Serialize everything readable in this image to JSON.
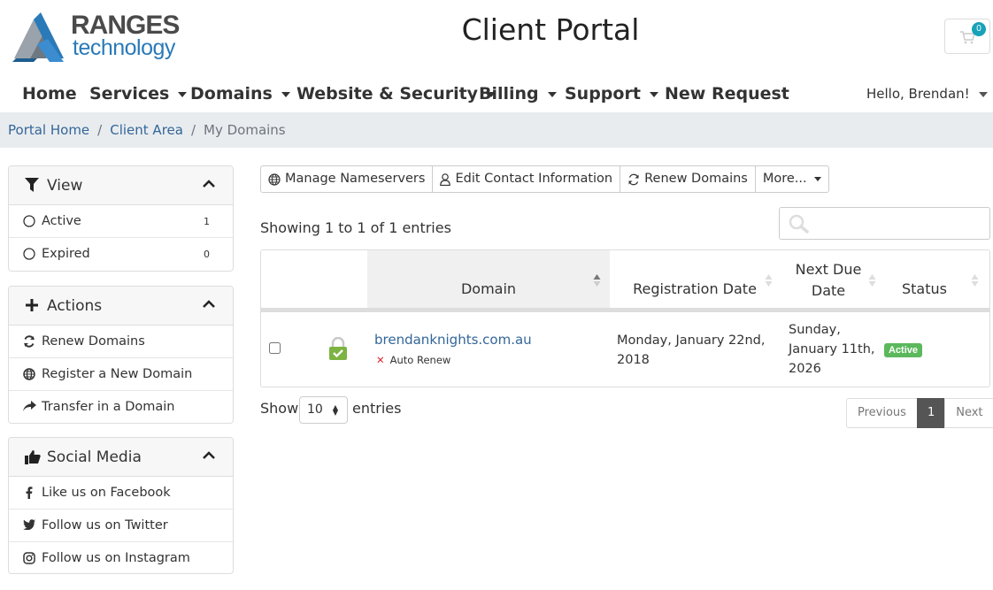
{
  "logo": {
    "line1": "RANGES",
    "line2": "technology"
  },
  "header": {
    "title": "Client Portal",
    "cart_count": "0"
  },
  "nav": {
    "items": [
      "Home",
      "Services",
      "Domains",
      "Website & Security",
      "Billing",
      "Support",
      "New Request"
    ],
    "user": "Hello, Brendan!"
  },
  "breadcrumb": {
    "home": "Portal Home",
    "area": "Client Area",
    "current": "My Domains",
    "sep": "/"
  },
  "sidebar": {
    "view": {
      "title": "View",
      "items": [
        {
          "label": "Active",
          "count": "1"
        },
        {
          "label": "Expired",
          "count": "0"
        }
      ]
    },
    "actions": {
      "title": "Actions",
      "items": [
        "Renew Domains",
        "Register a New Domain",
        "Transfer in a Domain"
      ]
    },
    "social": {
      "title": "Social Media",
      "items": [
        "Like us on Facebook",
        "Follow us on Twitter",
        "Follow us on Instagram"
      ]
    }
  },
  "toolbar": {
    "nameservers": "Manage Nameservers",
    "contact": "Edit Contact Information",
    "renew": "Renew Domains",
    "more": "More..."
  },
  "table": {
    "showing": "Showing 1 to 1 of 1 entries",
    "headers": {
      "domain": "Domain",
      "reg": "Registration Date",
      "next1": "Next Due",
      "next2": "Date",
      "status": "Status"
    },
    "rows": [
      {
        "domain": "brendanknights.com.au",
        "auto_renew": "Auto Renew",
        "reg1": "Monday, January 22nd,",
        "reg2": "2018",
        "next1": "Sunday,",
        "next2": "January 11th,",
        "next3": "2026",
        "status": "Active"
      }
    ]
  },
  "footer": {
    "show": "Show",
    "entries": "entries",
    "page_size": "10",
    "prev": "Previous",
    "page": "1",
    "next": "Next"
  },
  "colors": {
    "link": "#336699",
    "active_badge": "#5cb85c",
    "cart_badge": "#17a2b8",
    "lock": "#8bc34a"
  }
}
